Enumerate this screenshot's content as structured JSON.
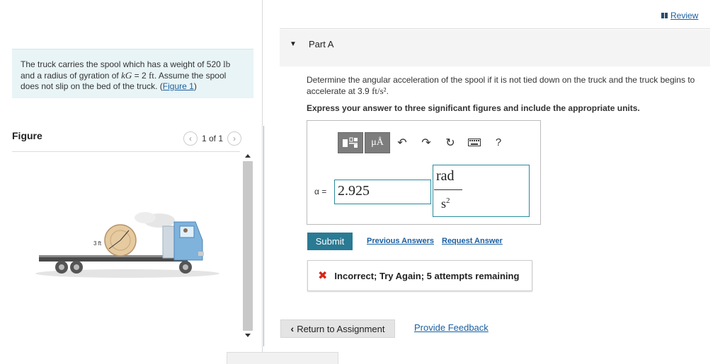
{
  "problem": {
    "text_prefix": "The truck carries the spool which has a weight of 520 ",
    "weight_unit": "lb",
    "text_mid1": " and a radius of gyration of ",
    "kg_symbol": "kG",
    "kg_eq": " = 2 ",
    "kg_unit": "ft",
    "text_mid2": ". Assume the spool does not slip on the bed of the truck. (",
    "figure_link": "Figure 1",
    "text_end": ")"
  },
  "figure": {
    "title": "Figure",
    "pager_text": "1 of 1",
    "dim_label": "3 ft",
    "prev_icon": "chevron-left-icon",
    "next_icon": "chevron-right-icon"
  },
  "header": {
    "review_label": "Review"
  },
  "part": {
    "label": "Part A"
  },
  "question": {
    "text": "Determine the angular acceleration of the spool if it is not tied down on the truck and the truck begins to accelerate at 3.9 ",
    "unit": "ft/s²",
    "text_end": ".",
    "instruction": "Express your answer to three significant figures and include the appropriate units."
  },
  "answer": {
    "variable_label": "α =",
    "value": "2.925",
    "unit_numerator": "rad",
    "unit_denominator": "s",
    "unit_exponent": "2",
    "toolbar": [
      "templates-icon",
      "units-icon",
      "undo-icon",
      "redo-icon",
      "reset-icon",
      "keyboard-icon",
      "help-icon"
    ],
    "help_label": "?",
    "units_label": "μÅ"
  },
  "actions": {
    "submit_label": "Submit",
    "previous_answers": "Previous Answers",
    "request_answer": "Request Answer"
  },
  "feedback": {
    "message": "Incorrect; Try Again; 5 attempts remaining"
  },
  "footer": {
    "return_label": "Return to Assignment",
    "provide_feedback": "Provide Feedback"
  },
  "colors": {
    "accent": "#2a7a94",
    "link": "#1a5fa0",
    "error": "#d4281c",
    "problem_bg": "#e8f4f6"
  }
}
